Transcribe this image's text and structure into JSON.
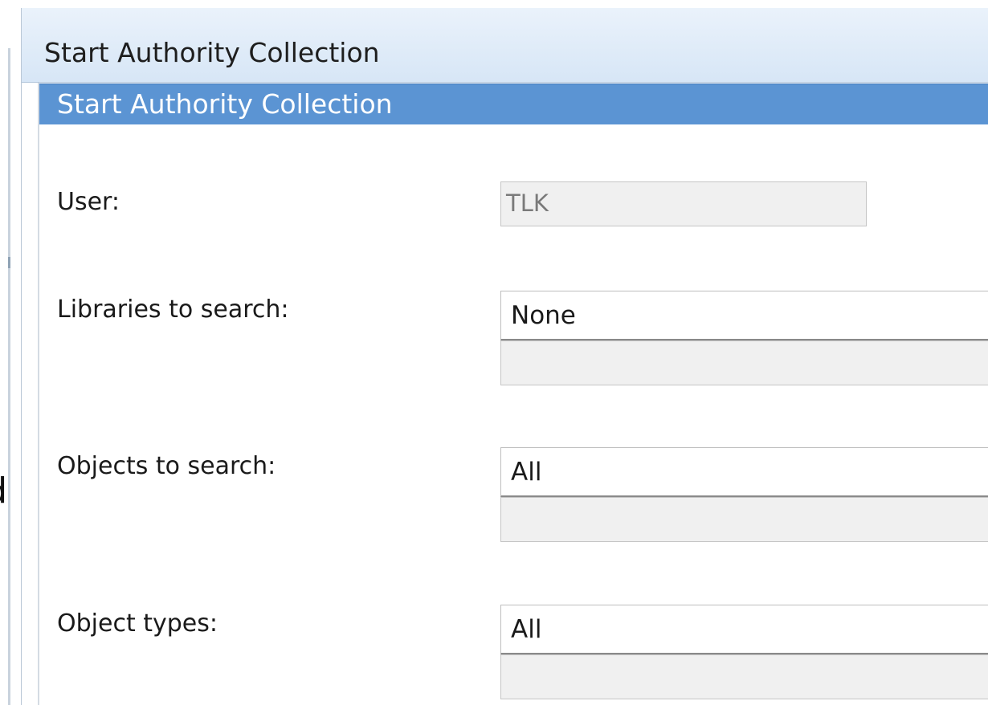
{
  "dialog": {
    "title": "Start Authority Collection"
  },
  "panel": {
    "header": "Start Authority Collection"
  },
  "fields": {
    "user": {
      "label": "User:",
      "value": "TLK"
    },
    "libraries": {
      "label": "Libraries to search:",
      "selected": "None",
      "entry_value": ""
    },
    "objects": {
      "label": "Objects to search:",
      "selected": "All",
      "entry_value": ""
    },
    "object_types": {
      "label": "Object types:",
      "selected": "All",
      "entry_value": ""
    }
  },
  "colors": {
    "panel_header_bg": "#5b94d3",
    "titlebar_bg": "#d7e6f6",
    "readonly_bg": "#f0f0f0"
  }
}
